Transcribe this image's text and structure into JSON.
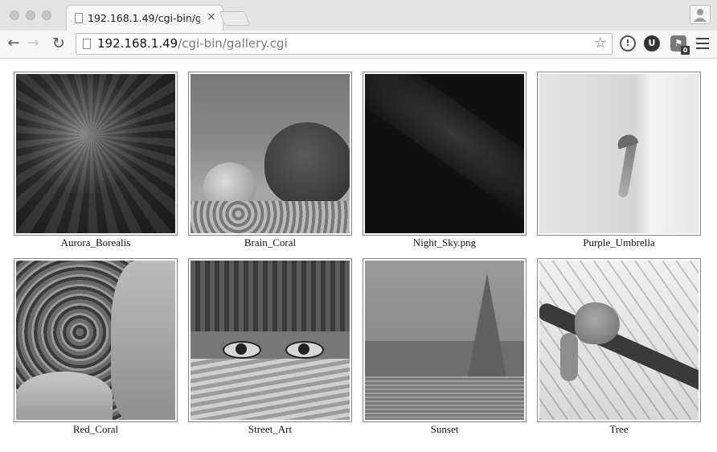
{
  "browser": {
    "tab_title": "192.168.1.49/cgi-bin/galle",
    "tab_close_glyph": "×",
    "url_host": "192.168.1.49",
    "url_path": "/cgi-bin/gallery.cgi",
    "nav_icons": {
      "back": "←",
      "forward": "→",
      "reload": "↻",
      "star": "☆"
    },
    "extensions": [
      {
        "name": "info-extension-icon",
        "glyph": "!"
      },
      {
        "name": "ublock-extension-icon",
        "glyph": "U"
      },
      {
        "name": "ghostery-extension-icon",
        "glyph": "⚑",
        "badge": "0"
      }
    ]
  },
  "gallery": {
    "items": [
      {
        "caption": "Aurora_Borealis"
      },
      {
        "caption": "Brain_Coral"
      },
      {
        "caption": "Night_Sky.png"
      },
      {
        "caption": "Purple_Umbrella"
      },
      {
        "caption": "Red_Coral"
      },
      {
        "caption": "Street_Art"
      },
      {
        "caption": "Sunset"
      },
      {
        "caption": "Tree"
      }
    ]
  }
}
